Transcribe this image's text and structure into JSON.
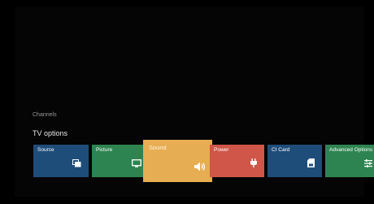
{
  "section_label": "Channels",
  "row_title": "TV options",
  "tiles": [
    {
      "label": "Source",
      "icon": "source-icon",
      "color": "#1f4d7a"
    },
    {
      "label": "Picture",
      "icon": "monitor-icon",
      "color": "#2e8451"
    },
    {
      "label": "Sound",
      "icon": "speaker-icon",
      "color": "#e7ad52",
      "focused": true
    },
    {
      "label": "Power",
      "icon": "plug-icon",
      "color": "#cf5648"
    },
    {
      "label": "CI Card",
      "icon": "sd-card-icon",
      "color": "#1f4d7a"
    },
    {
      "label": "Advanced Options",
      "icon": "settings-sliders-icon",
      "color": "#2e8451"
    }
  ]
}
